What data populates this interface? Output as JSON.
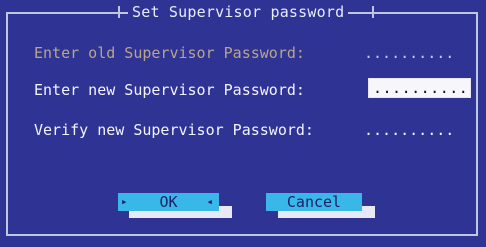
{
  "dialog": {
    "title": "Set Supervisor password"
  },
  "fields": {
    "old_label": "Enter old Supervisor Password:",
    "old_value": "..........",
    "new_label": "Enter new Supervisor Password:",
    "new_value": "..........",
    "verify_label": "Verify new Supervisor Password:",
    "verify_value": ".........."
  },
  "buttons": {
    "ok_label": "OK",
    "cancel_label": "Cancel",
    "ok_left_marker": "▸",
    "ok_right_marker": "◂"
  },
  "colors": {
    "background": "#2f3394",
    "button": "#38b7e8",
    "button_shadow": "#e7e9f7",
    "disabled_text": "#b9a58a",
    "input_bg": "#f7f7fb"
  }
}
